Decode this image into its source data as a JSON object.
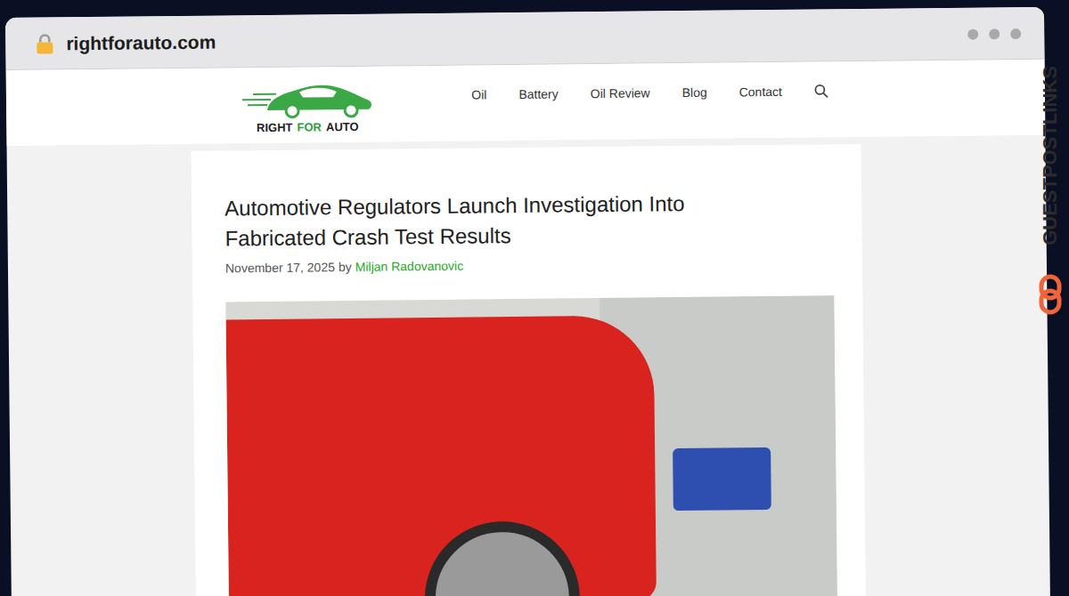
{
  "browser": {
    "url": "rightforauto.com"
  },
  "site": {
    "logo": {
      "words": [
        {
          "text": "RIGHT",
          "color": "#1f1f1f"
        },
        {
          "text": "FOR",
          "color": "#2f9e3a"
        },
        {
          "text": "AUTO",
          "color": "#1f1f1f"
        }
      ]
    },
    "nav": [
      "Oil",
      "Battery",
      "Oil Review",
      "Blog",
      "Contact"
    ]
  },
  "article": {
    "title": "Automotive Regulators Launch Investigation Into Fabricated Crash Test Results",
    "date": "November 17, 2025",
    "by": "by",
    "author": "Miljan Radovanovic"
  },
  "watermark": {
    "text": "GUESTPOSTLINKS"
  }
}
